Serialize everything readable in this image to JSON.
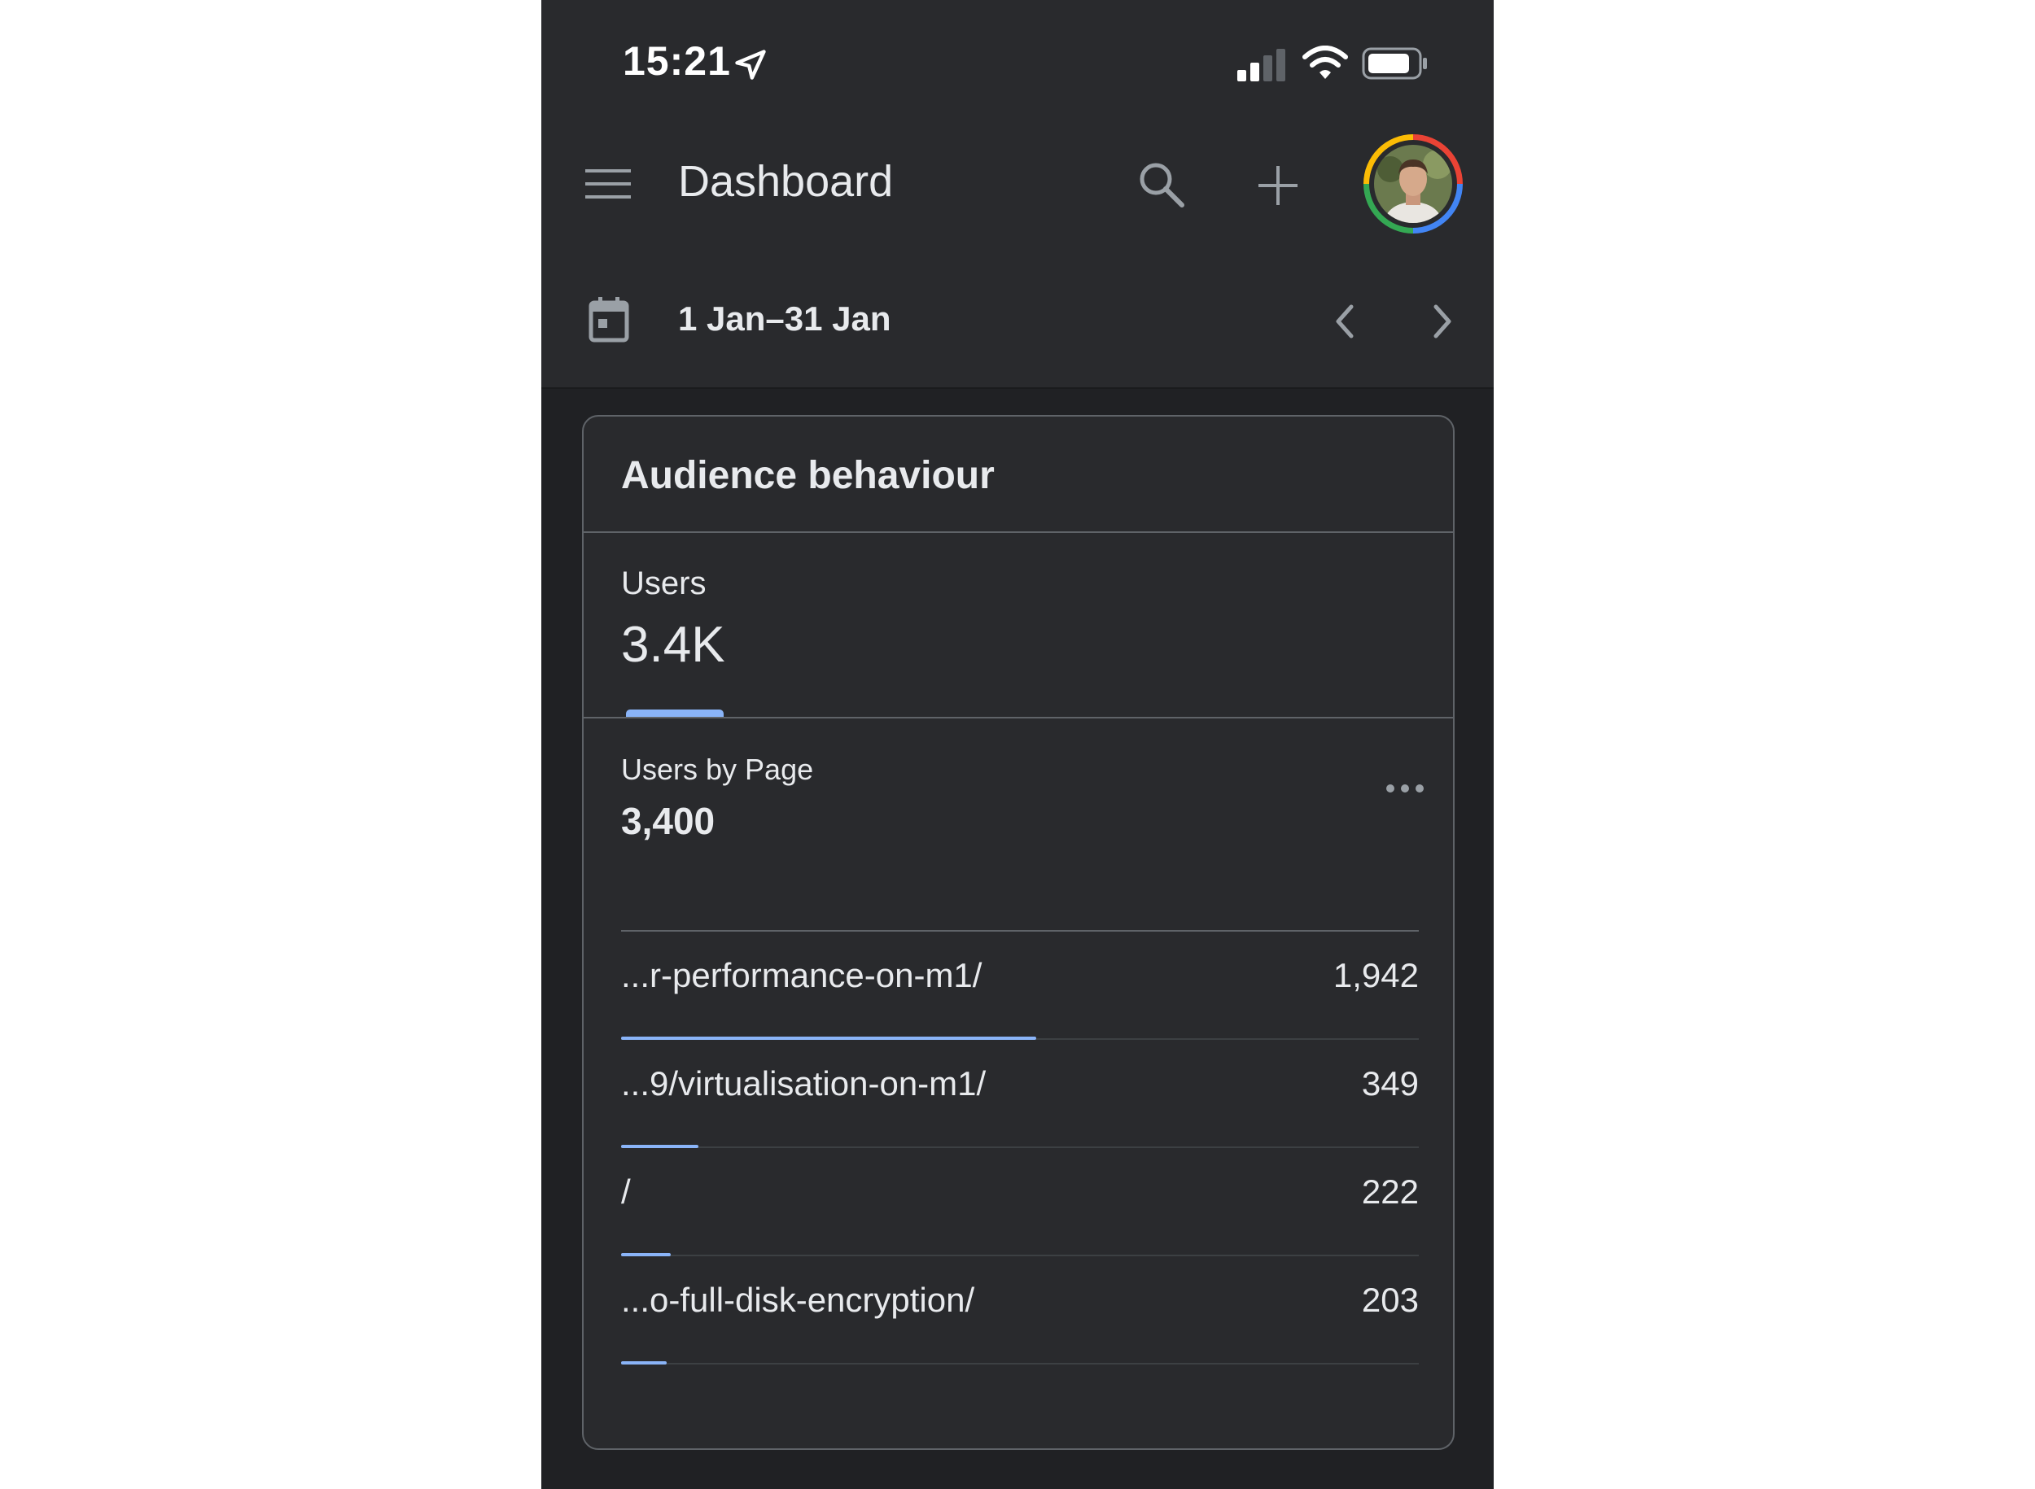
{
  "status_bar": {
    "time": "15:21"
  },
  "app_bar": {
    "title": "Dashboard"
  },
  "date_bar": {
    "range": "1 Jan–31 Jan"
  },
  "card": {
    "title": "Audience behaviour",
    "metric": {
      "label": "Users",
      "value": "3.4K"
    },
    "section": {
      "title": "Users by Page",
      "total": "3,400",
      "rows": [
        {
          "label": "...r-performance-on-m1/",
          "value": "1,942",
          "bar_fraction": 0.52
        },
        {
          "label": "...9/virtualisation-on-m1/",
          "value": "349",
          "bar_fraction": 0.097
        },
        {
          "label": "/",
          "value": "222",
          "bar_fraction": 0.062
        },
        {
          "label": "...o-full-disk-encryption/",
          "value": "203",
          "bar_fraction": 0.057
        }
      ]
    }
  },
  "icons": [
    "location-arrow-icon",
    "signal-icon",
    "wifi-icon",
    "battery-icon",
    "menu-icon",
    "search-icon",
    "add-icon",
    "calendar-icon",
    "chevron-left-icon",
    "chevron-right-icon",
    "more-horiz-icon"
  ],
  "colors": {
    "background": "#202124",
    "surface": "#292a2d",
    "accent": "#8ab4f8",
    "border": "#5f6368"
  }
}
